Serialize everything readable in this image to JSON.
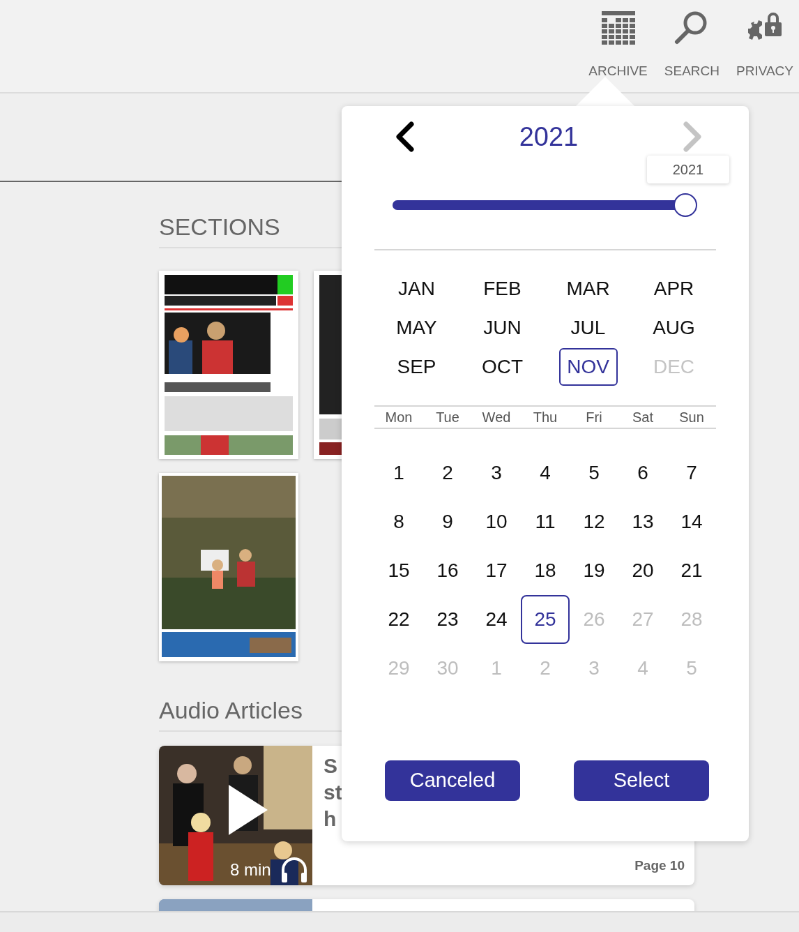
{
  "nav": [
    {
      "label": "ARCHIVE"
    },
    {
      "label": "SEARCH"
    },
    {
      "label": "PRIVACY"
    }
  ],
  "sections": {
    "title": "SECTIONS",
    "thumbnails": [
      {
        "kind": "picture"
      },
      {
        "kind": "picture"
      },
      {
        "kind": "picture"
      }
    ]
  },
  "audio": {
    "title": "Audio Articles",
    "articles": [
      {
        "title_lines": [
          "S",
          "st",
          "h"
        ],
        "duration": "8 min",
        "page": "Page 10"
      },
      {
        "kind": "picture"
      }
    ]
  },
  "picker": {
    "year": "2021",
    "prev_disabled": false,
    "next_disabled": true,
    "slider": {
      "level": 1,
      "tooltip": "2021"
    },
    "months": [
      {
        "label": "JAN",
        "selected": false,
        "disabled": false
      },
      {
        "label": "FEB",
        "selected": false,
        "disabled": false
      },
      {
        "label": "MAR",
        "selected": false,
        "disabled": false
      },
      {
        "label": "APR",
        "selected": false,
        "disabled": false
      },
      {
        "label": "MAY",
        "selected": false,
        "disabled": false
      },
      {
        "label": "JUN",
        "selected": false,
        "disabled": false
      },
      {
        "label": "JUL",
        "selected": false,
        "disabled": false
      },
      {
        "label": "AUG",
        "selected": false,
        "disabled": false
      },
      {
        "label": "SEP",
        "selected": false,
        "disabled": false
      },
      {
        "label": "OCT",
        "selected": false,
        "disabled": false
      },
      {
        "label": "NOV",
        "selected": true,
        "disabled": false
      },
      {
        "label": "DEC",
        "selected": false,
        "disabled": true
      }
    ],
    "weekdays": [
      "Mon",
      "Tue",
      "Wed",
      "Thu",
      "Fri",
      "Sat",
      "Sun"
    ],
    "days": [
      {
        "label": "1",
        "selected": false,
        "disabled": false
      },
      {
        "label": "2",
        "selected": false,
        "disabled": false
      },
      {
        "label": "3",
        "selected": false,
        "disabled": false
      },
      {
        "label": "4",
        "selected": false,
        "disabled": false
      },
      {
        "label": "5",
        "selected": false,
        "disabled": false
      },
      {
        "label": "6",
        "selected": false,
        "disabled": false
      },
      {
        "label": "7",
        "selected": false,
        "disabled": false
      },
      {
        "label": "8",
        "selected": false,
        "disabled": false
      },
      {
        "label": "9",
        "selected": false,
        "disabled": false
      },
      {
        "label": "10",
        "selected": false,
        "disabled": false
      },
      {
        "label": "11",
        "selected": false,
        "disabled": false
      },
      {
        "label": "12",
        "selected": false,
        "disabled": false
      },
      {
        "label": "13",
        "selected": false,
        "disabled": false
      },
      {
        "label": "14",
        "selected": false,
        "disabled": false
      },
      {
        "label": "15",
        "selected": false,
        "disabled": false
      },
      {
        "label": "16",
        "selected": false,
        "disabled": false
      },
      {
        "label": "17",
        "selected": false,
        "disabled": false
      },
      {
        "label": "18",
        "selected": false,
        "disabled": false
      },
      {
        "label": "19",
        "selected": false,
        "disabled": false
      },
      {
        "label": "20",
        "selected": false,
        "disabled": false
      },
      {
        "label": "21",
        "selected": false,
        "disabled": false
      },
      {
        "label": "22",
        "selected": false,
        "disabled": false
      },
      {
        "label": "23",
        "selected": false,
        "disabled": false
      },
      {
        "label": "24",
        "selected": false,
        "disabled": false
      },
      {
        "label": "25",
        "selected": true,
        "disabled": false
      },
      {
        "label": "26",
        "selected": false,
        "disabled": true
      },
      {
        "label": "27",
        "selected": false,
        "disabled": true
      },
      {
        "label": "28",
        "selected": false,
        "disabled": true
      },
      {
        "label": "29",
        "selected": false,
        "disabled": true
      },
      {
        "label": "30",
        "selected": false,
        "disabled": true
      },
      {
        "label": "1",
        "selected": false,
        "disabled": true
      },
      {
        "label": "2",
        "selected": false,
        "disabled": true
      },
      {
        "label": "3",
        "selected": false,
        "disabled": true
      },
      {
        "label": "4",
        "selected": false,
        "disabled": true
      },
      {
        "label": "5",
        "selected": false,
        "disabled": true
      }
    ],
    "buttons": [
      "Canceled",
      "Select"
    ]
  }
}
